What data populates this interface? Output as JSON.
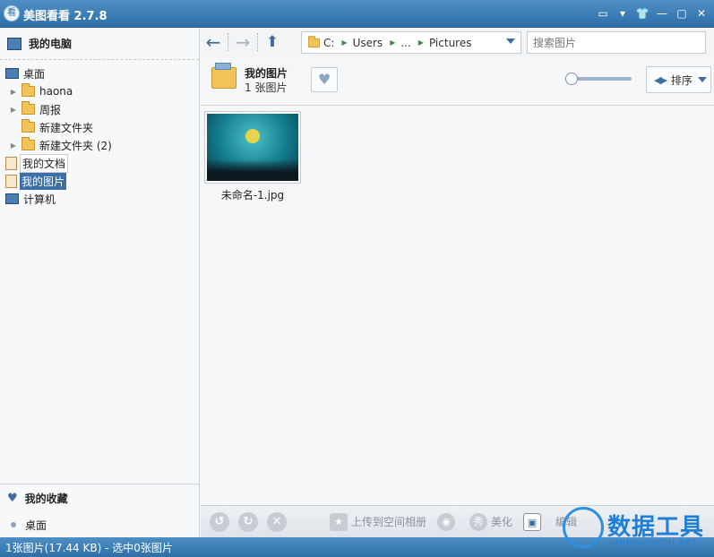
{
  "window": {
    "app_icon_char": "看",
    "title": "美图看看 2.7.8"
  },
  "titlebar": {
    "icons": [
      "chat-icon",
      "menu-icon",
      "skin-icon",
      "minimize-icon",
      "maximize-icon",
      "close-icon"
    ],
    "glyphs": [
      "▭",
      "▾",
      "👕",
      "—",
      "▢",
      "✕"
    ]
  },
  "sidebar": {
    "computer_label": "我的电脑",
    "tree": [
      {
        "label": "桌面",
        "level": 0,
        "icon": "monitor-icon"
      },
      {
        "label": "haona",
        "level": 1,
        "icon": "folder-icon"
      },
      {
        "label": "周报",
        "level": 1,
        "icon": "folder-icon"
      },
      {
        "label": "新建文件夹",
        "level": 1,
        "icon": "folder-icon"
      },
      {
        "label": "新建文件夹 (2)",
        "level": 1,
        "icon": "folder-icon"
      },
      {
        "label": "我的文档",
        "level": 0,
        "icon": "document-icon"
      },
      {
        "label": "我的图片",
        "level": 0,
        "icon": "pictures-icon",
        "selected": true
      },
      {
        "label": "计算机",
        "level": 0,
        "icon": "computer-icon"
      }
    ],
    "favorites_label": "我的收藏",
    "favorites": [
      {
        "label": "桌面"
      }
    ]
  },
  "toolbar": {
    "back_glyph": "←",
    "forward_glyph": "→",
    "up_glyph": "⬆",
    "address": {
      "drive": "C:",
      "segments": [
        "Users",
        "...",
        "Pictures"
      ]
    },
    "search_placeholder": "搜索图片"
  },
  "info": {
    "folder_name": "我的图片",
    "count": "1 张图片",
    "heart_glyph": "♥",
    "sort_label": "排序",
    "zoom": 0.1
  },
  "files": [
    {
      "name": "未命名-1.jpg"
    }
  ],
  "bottom": {
    "rotate_left": "↺",
    "rotate_right": "↻",
    "delete": "✕",
    "upload_label": "上传到空间相册",
    "beautify_label": "美化",
    "beautify_badge": "秀",
    "edit_label": "编辑"
  },
  "status": "1张图片(17.44 KB) - 选中0张图片",
  "watermark": {
    "title": "数据工具",
    "sub": "JIHUOGONGJU.NET"
  },
  "colors": {
    "accent": "#2f6fa8",
    "selection": "#3c6fa5"
  }
}
